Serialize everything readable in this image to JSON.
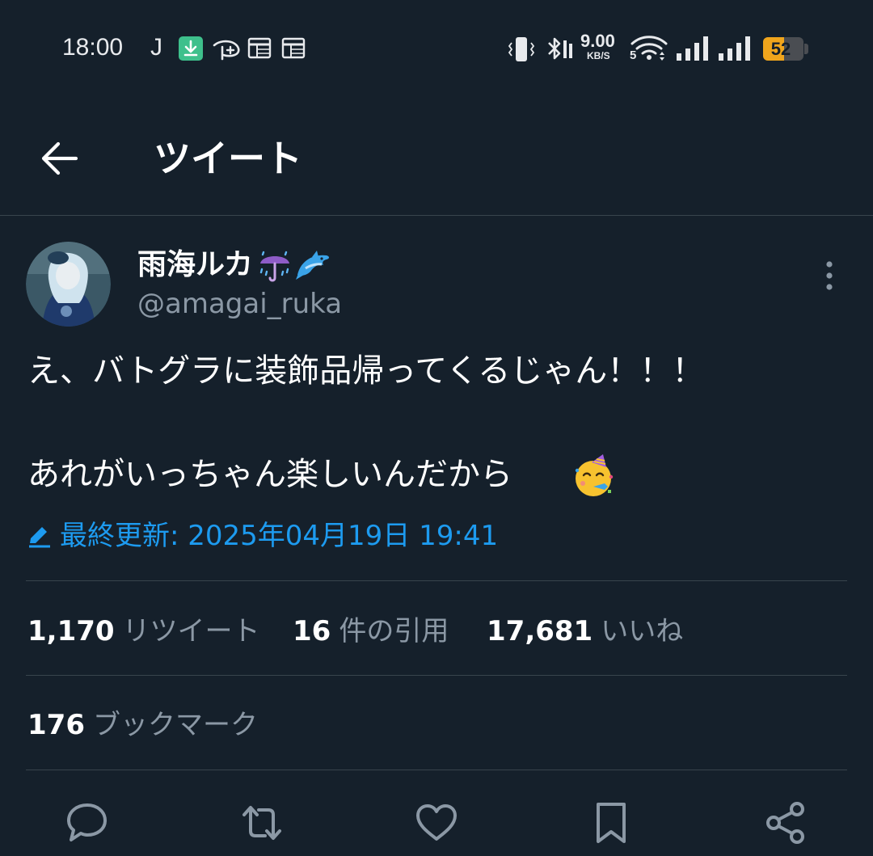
{
  "status_bar": {
    "time": "18:00",
    "carrier_glyph": "J",
    "net_speed_value": "9.00",
    "net_speed_unit": "KB/S",
    "wifi_label": "5",
    "battery_level": "52",
    "battery_fraction": 0.52,
    "battery_color": "#f0a51c",
    "left_icons": [
      "download-icon",
      "disney-plus-icon",
      "calendar-icon",
      "calendar-icon"
    ],
    "right_icons": [
      "vibrate-icon",
      "bluetooth-icon",
      "wifi-icon",
      "signal-icon",
      "signal-icon",
      "battery-icon"
    ]
  },
  "header": {
    "title": "ツイート",
    "back_icon": "arrow-left-icon"
  },
  "tweet": {
    "display_name": "雨海ルカ",
    "name_emojis": [
      "umbrella-with-rain-icon",
      "dolphin-icon"
    ],
    "username": "@amagai_ruka",
    "lines": [
      "え、バトグラに装飾品帰ってくるじゃん！！！",
      "あれがいっちゃん楽しいんだから"
    ],
    "trailing_emoji": "partying-face-icon",
    "edited_label": "最終更新: 2025年04月19日 19:41",
    "accent_color": "#1d9bf0"
  },
  "stats": {
    "retweets_count": "1,170",
    "retweets_label": "リツイート",
    "quotes_count": "16",
    "quotes_label": "件の引用",
    "likes_count": "17,681",
    "likes_label": "いいね",
    "bookmarks_count": "176",
    "bookmarks_label": "ブックマーク"
  },
  "actions": [
    "reply-icon",
    "retweet-icon",
    "like-icon",
    "bookmark-icon",
    "share-icon"
  ],
  "colors": {
    "background": "#15202b",
    "divider": "#38444d",
    "secondary_text": "#8b98a5"
  }
}
